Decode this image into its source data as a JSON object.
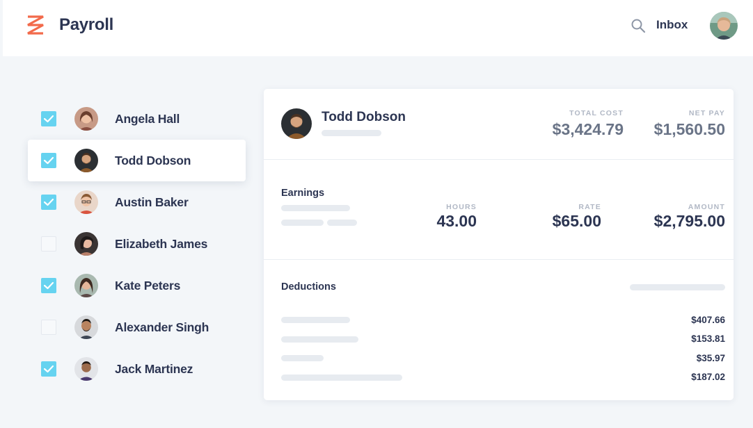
{
  "app": {
    "title": "Payroll",
    "inbox_label": "Inbox"
  },
  "employees": [
    {
      "name": "Angela Hall",
      "checked": true
    },
    {
      "name": "Todd Dobson",
      "checked": true,
      "selected": true
    },
    {
      "name": "Austin Baker",
      "checked": true
    },
    {
      "name": "Elizabeth James",
      "checked": false
    },
    {
      "name": "Kate Peters",
      "checked": true
    },
    {
      "name": "Alexander Singh",
      "checked": false
    },
    {
      "name": "Jack Martinez",
      "checked": true
    }
  ],
  "detail": {
    "name": "Todd Dobson",
    "total_cost_label": "TOTAL COST",
    "total_cost": "$3,424.79",
    "net_pay_label": "NET PAY",
    "net_pay": "$1,560.50",
    "earnings": {
      "title": "Earnings",
      "hours_label": "HOURS",
      "hours": "43.00",
      "rate_label": "RATE",
      "rate": "$65.00",
      "amount_label": "AMOUNT",
      "amount": "$2,795.00"
    },
    "deductions": {
      "title": "Deductions",
      "amounts": [
        "$407.66",
        "$153.81",
        "$35.97",
        "$187.02"
      ]
    }
  },
  "colors": {
    "accent_logo": "#f26a4b",
    "check": "#66d3f0",
    "text_dark": "#2c3552",
    "background": "#f3f6f9"
  },
  "icons": {
    "search": "search-icon",
    "check": "check-icon",
    "logo": "logo-icon"
  }
}
